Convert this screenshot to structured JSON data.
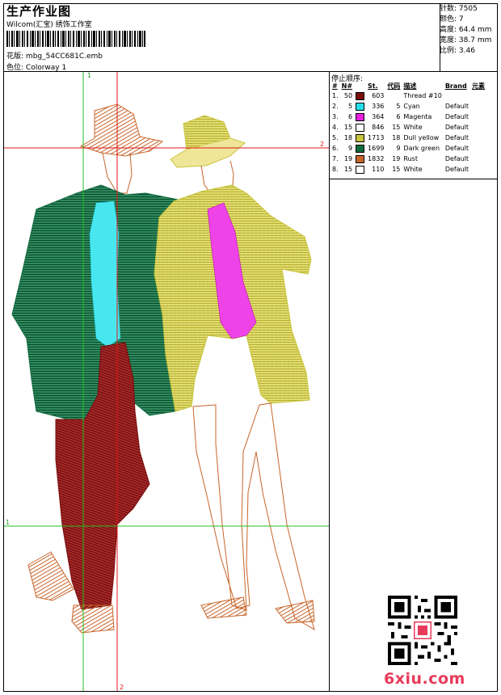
{
  "header": {
    "title": "生产作业图",
    "subtitle": "Wilcom(汇宝) 绣饰工作室",
    "design_label": "花版:",
    "design_value": "mbg_54CC681C.emb",
    "colorway_label": "色位:",
    "colorway_value": "Colorway 1"
  },
  "specs": [
    {
      "label": "针数:",
      "value": "7505"
    },
    {
      "label": "颜色:",
      "value": "7"
    },
    {
      "label": "高度:",
      "value": "64.4 mm"
    },
    {
      "label": "宽度:",
      "value": "38.7 mm"
    },
    {
      "label": "比例:",
      "value": "3.46"
    }
  ],
  "stop_sequence_title": "停止顺序:",
  "table_headers": {
    "num": "#",
    "n": "N#",
    "st": "St.",
    "code": "代码",
    "desc": "描述",
    "brand": "Brand",
    "elem": "元素"
  },
  "threads": [
    {
      "num": "1.",
      "n": "50",
      "color": "#7a0c0c",
      "st": "603",
      "code": "",
      "desc": "Thread #10",
      "brand": ""
    },
    {
      "num": "2.",
      "n": "5",
      "color": "#22e0ea",
      "st": "336",
      "code": "5",
      "desc": "Cyan",
      "brand": "Default"
    },
    {
      "num": "3.",
      "n": "6",
      "color": "#e81ee0",
      "st": "364",
      "code": "6",
      "desc": "Magenta",
      "brand": "Default"
    },
    {
      "num": "4.",
      "n": "15",
      "color": "#ffffff",
      "st": "846",
      "code": "15",
      "desc": "White",
      "brand": "Default"
    },
    {
      "num": "5.",
      "n": "18",
      "color": "#c9c43a",
      "st": "1713",
      "code": "18",
      "desc": "Dull yellow",
      "brand": "Default"
    },
    {
      "num": "6.",
      "n": "9",
      "color": "#0f6b3e",
      "st": "1699",
      "code": "9",
      "desc": "Dark green",
      "brand": "Default"
    },
    {
      "num": "7.",
      "n": "19",
      "color": "#c8652a",
      "st": "1832",
      "code": "19",
      "desc": "Rust",
      "brand": "Default"
    },
    {
      "num": "8.",
      "n": "15",
      "color": "#ffffff",
      "st": "110",
      "code": "15",
      "desc": "White",
      "brand": "Default"
    }
  ],
  "axis_markers": {
    "green_v": "1",
    "green_h": "1",
    "red_h": "2",
    "red_v": "2"
  },
  "watermark": "6xiu.com",
  "colors": {
    "green_guide": "#22c022",
    "red_guide": "#e01818"
  }
}
